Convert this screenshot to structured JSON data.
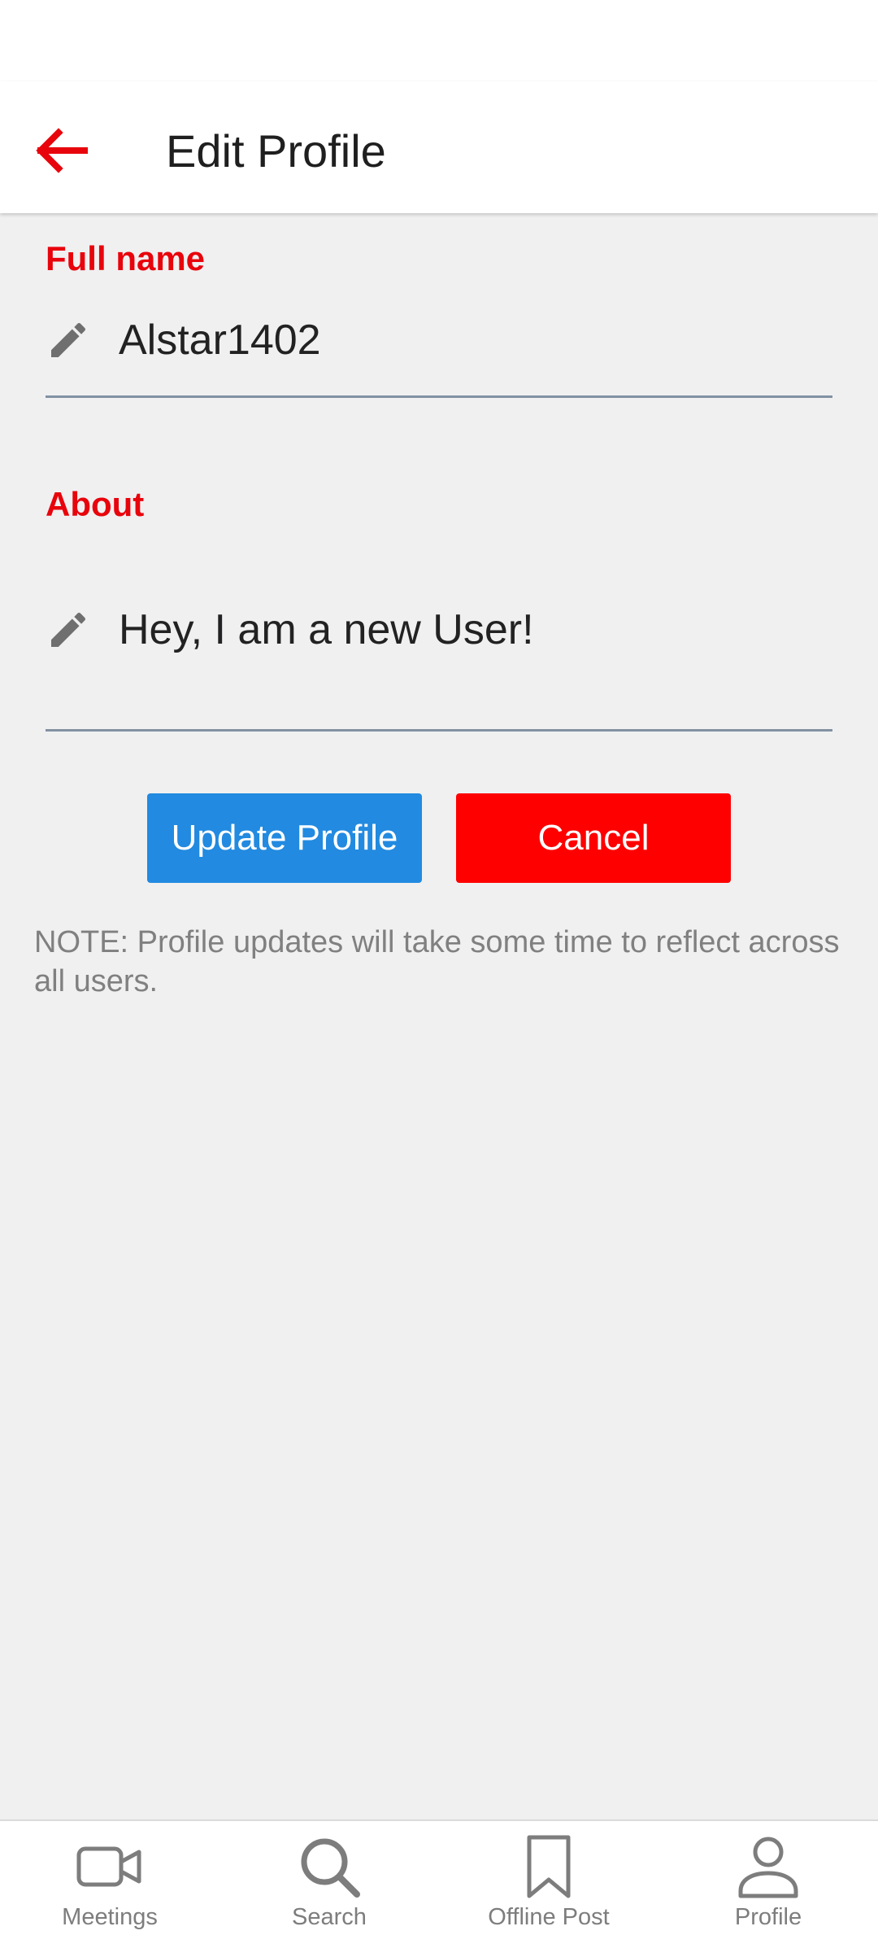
{
  "header": {
    "title": "Edit Profile",
    "back_icon": "arrow-back-icon",
    "accent_color": "#e8040c"
  },
  "form": {
    "full_name": {
      "label": "Full name",
      "value": "Alstar1402",
      "icon": "pencil-icon"
    },
    "about": {
      "label": "About",
      "value": "Hey, I am a new User!",
      "icon": "pencil-icon"
    }
  },
  "buttons": {
    "update_label": "Update Profile",
    "update_color": "#228ae0",
    "cancel_label": "Cancel",
    "cancel_color": "#fe0000"
  },
  "note": "NOTE: Profile updates will take some time to reflect across all users.",
  "bottom_nav": {
    "items": [
      {
        "label": "Meetings",
        "icon": "video-camera-icon"
      },
      {
        "label": "Search",
        "icon": "search-icon"
      },
      {
        "label": "Offline Post",
        "icon": "bookmark-icon"
      },
      {
        "label": "Profile",
        "icon": "person-icon"
      }
    ]
  }
}
